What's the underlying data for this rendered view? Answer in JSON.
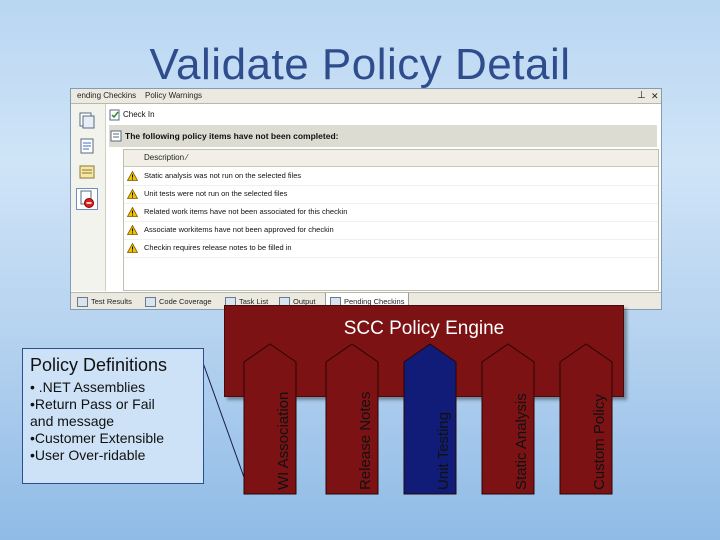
{
  "slide": {
    "title": "Validate Policy Detail"
  },
  "vs": {
    "tabs": [
      "ending Checkins",
      "Policy Warnings"
    ],
    "pin": "⊥",
    "close": "✕",
    "checkin_label": "Check In",
    "warning_header": "The following policy items have not been completed:",
    "column_header": "Description ⁄",
    "rows": [
      "Static analysis was not run on the selected files",
      "Unit tests were not run on the selected files",
      "Related work items have not been associated for this checkin",
      "Associate workitems have not been approved for checkin",
      "Checkin requires release notes to be filled in"
    ],
    "bottom_tabs": [
      "Test Results",
      "Code Coverage",
      "Task List",
      "Output",
      "Pending Checkins"
    ]
  },
  "engine": {
    "label": "SCC Policy Engine"
  },
  "definitions": {
    "title": "Policy Definitions",
    "lines": [
      "• .NET Assemblies",
      "•Return Pass or Fail",
      "and message",
      "•Customer Extensible",
      "•User Over-ridable"
    ]
  },
  "policies": [
    "WI Association",
    "Release Notes",
    "Unit Testing",
    "Static Analysis",
    "Custom Policy"
  ],
  "colors": {
    "engine": "#7c1214",
    "arrow_fills": [
      "#7c1214",
      "#7c1214",
      "#111b78",
      "#7c1214",
      "#7c1214"
    ],
    "arrow_text_colors": [
      "#111111",
      "#111111",
      "#ffffff",
      "#111111",
      "#ffffff"
    ]
  }
}
